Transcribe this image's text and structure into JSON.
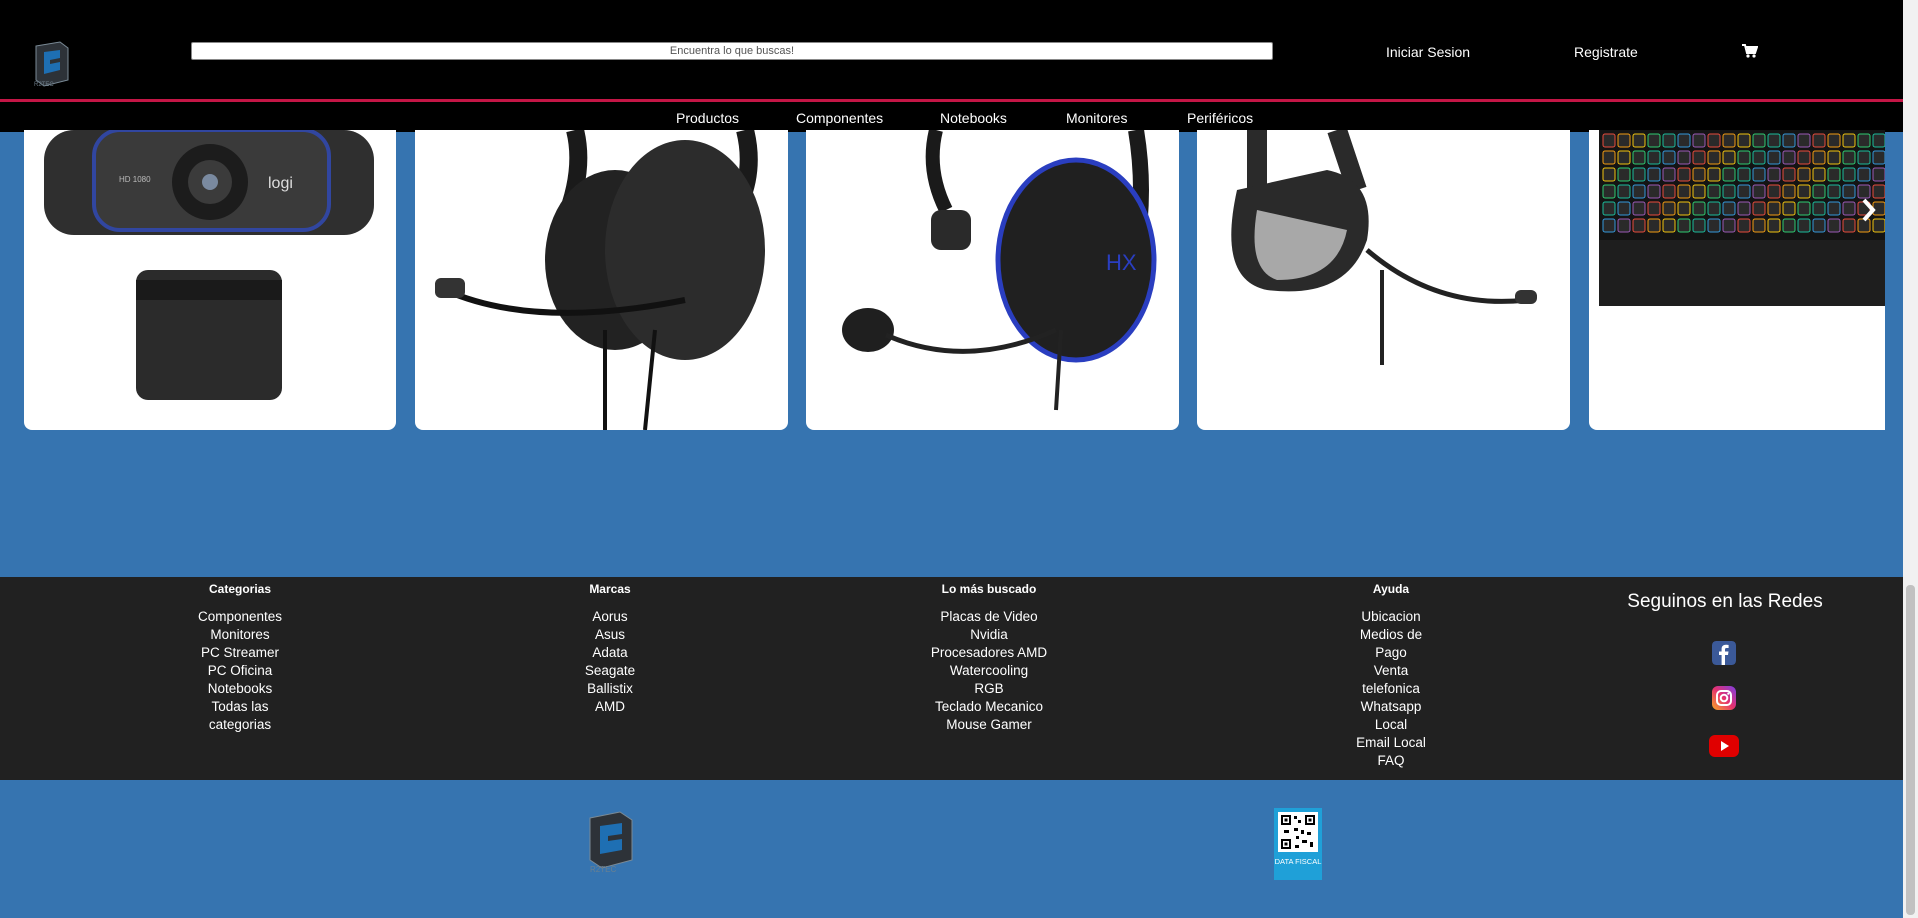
{
  "header": {
    "search_placeholder": "Encuentra lo que buscas!",
    "login": "Iniciar Sesion",
    "register": "Registrate"
  },
  "nav": [
    "Productos",
    "Componentes",
    "Notebooks",
    "Monitores",
    "Periféricos"
  ],
  "carousel": {
    "items": [
      {
        "name": "webcam",
        "brand": "logi",
        "label": "HD 1080"
      },
      {
        "name": "headset-1"
      },
      {
        "name": "headset-2"
      },
      {
        "name": "headset-3"
      },
      {
        "name": "keyboard"
      }
    ]
  },
  "footer": {
    "categorias": {
      "title": "Categorias",
      "items": [
        "Componentes",
        "Monitores",
        "PC Streamer",
        "PC Oficina",
        "Notebooks",
        "Todas las",
        "categorias"
      ]
    },
    "marcas": {
      "title": "Marcas",
      "items": [
        "Aorus",
        "Asus",
        "Adata",
        "Seagate",
        "Ballistix",
        "AMD"
      ]
    },
    "buscado": {
      "title": "Lo más buscado",
      "items": [
        "Placas de Video",
        "Nvidia",
        "Procesadores AMD",
        "Watercooling",
        "RGB",
        "Teclado Mecanico",
        "Mouse Gamer"
      ]
    },
    "ayuda": {
      "title": "Ayuda",
      "items": [
        "Ubicacion",
        "Medios de",
        "Pago",
        "Venta",
        "telefonica",
        "Whatsapp",
        "Local",
        "Email Local",
        "FAQ"
      ]
    },
    "social_title": "Seguinos en las Redes"
  },
  "qr_text": "DATA FISCAL",
  "colors": {
    "background": "#3674b0",
    "header": "#000000",
    "accent_line": "#c41646",
    "footer": "#212121",
    "facebook": "#3b5998",
    "youtube": "#e00000"
  }
}
